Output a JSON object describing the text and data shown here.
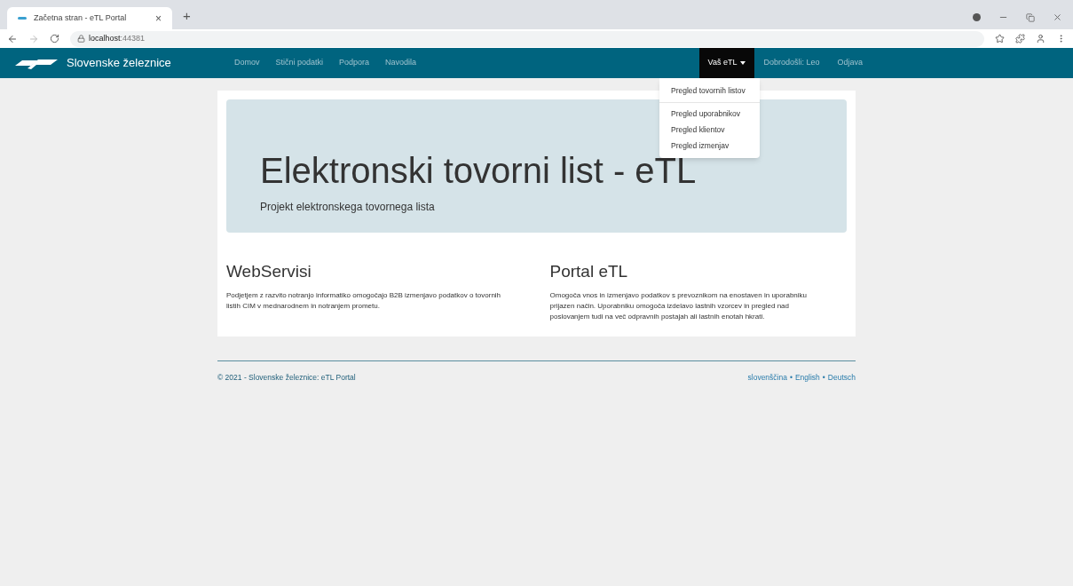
{
  "browser": {
    "tab_title": "Začetna stran - eTL Portal",
    "tab_close": "×",
    "new_tab": "+",
    "url_host": "localhost",
    "url_port": ":44381"
  },
  "navbar": {
    "brand": "Slovenske železnice",
    "links": [
      {
        "label": "Domov"
      },
      {
        "label": "Stični podatki"
      },
      {
        "label": "Podpora"
      },
      {
        "label": "Navodila"
      }
    ],
    "right": [
      {
        "kind": "dropdown",
        "label": "Vaš eTL",
        "selected": true
      },
      {
        "kind": "link",
        "label": "Dobrodošli: Leo",
        "selected": false
      },
      {
        "kind": "link",
        "label": "Odjava",
        "selected": false
      }
    ]
  },
  "dropdown": {
    "groups": [
      [
        "Pregled tovornih listov"
      ],
      [
        "Pregled uporabnikov",
        "Pregled klientov",
        "Pregled izmenjav"
      ]
    ]
  },
  "jumbotron": {
    "title": "Elektronski tovorni list - eTL",
    "subtitle": "Projekt elektronskega tovornega lista"
  },
  "columns": [
    {
      "heading": "WebServisi",
      "text": "Podjetjem z razvito notranjo informatiko omogočajo B2B izmenjavo podatkov o tovornih listih CIM v mednarodnem in notranjem prometu."
    },
    {
      "heading": "Portal eTL",
      "text": "Omogoča vnos in izmenjavo podatkov s prevoznikom na enostaven in uporabniku prijazen način. Uporabniku omogoča izdelavo lastnih vzorcev in pregled nad poslovanjem tudi na več odpravnih postajah ali lastnih enotah hkrati."
    }
  ],
  "footer": {
    "copyright": "© 2021 - Slovenske železnice: eTL Portal",
    "separator": "•",
    "languages": [
      "slovenščina",
      "English",
      "Deutsch"
    ]
  }
}
